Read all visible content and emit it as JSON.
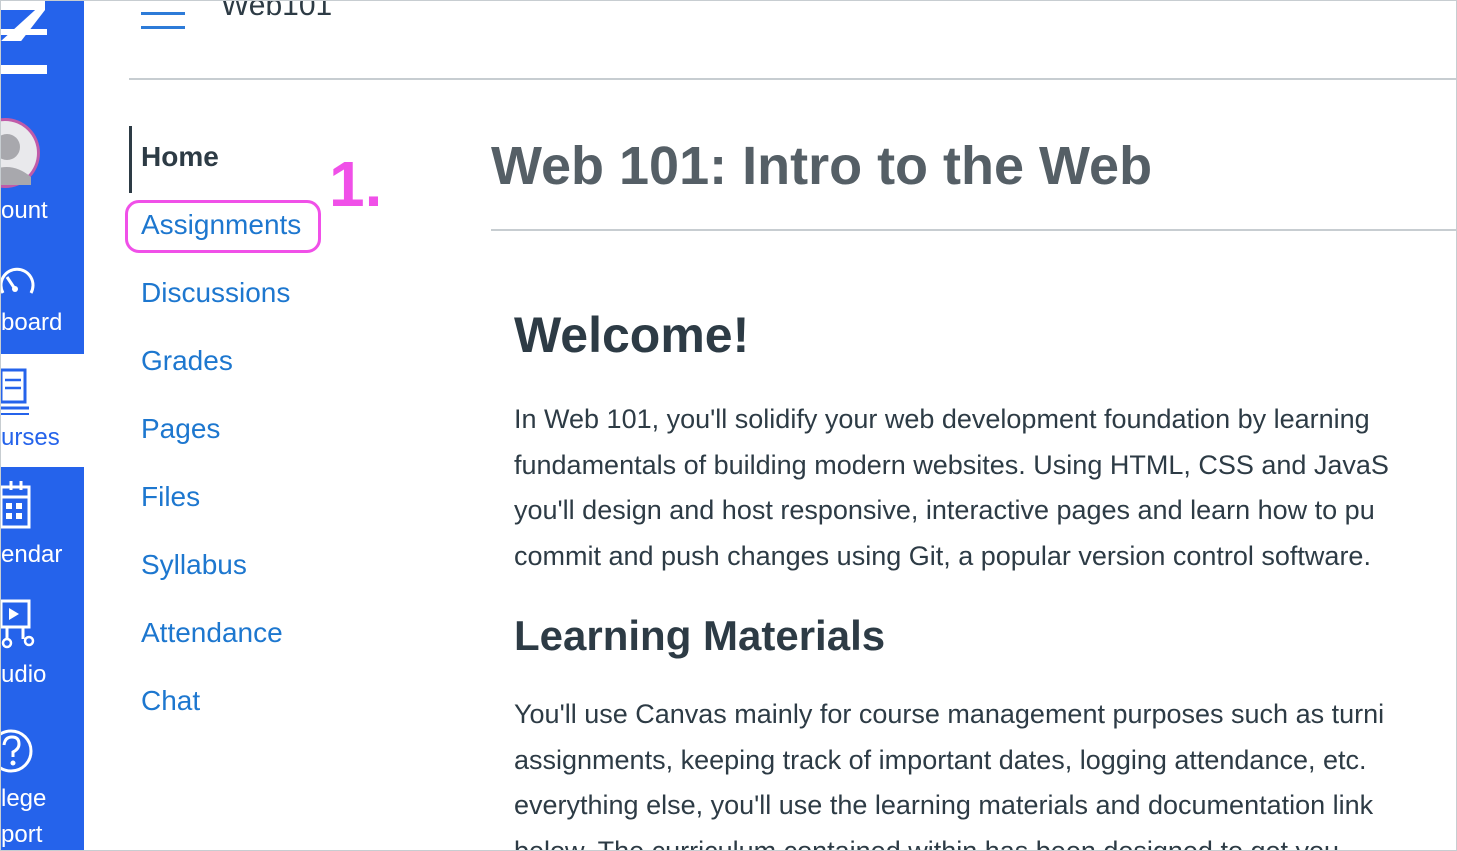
{
  "colors": {
    "global_nav_bg": "#2563eb",
    "link": "#1d77cf",
    "text": "#2d3b45",
    "annotation": "#f050e8"
  },
  "global_nav": {
    "items": [
      {
        "label": "ount",
        "icon": "user-avatar-icon"
      },
      {
        "label": "board",
        "icon": "dashboard-gauge-icon"
      },
      {
        "label": "urses",
        "icon": "courses-book-icon"
      },
      {
        "label": "endar",
        "icon": "calendar-icon"
      },
      {
        "label": "udio",
        "icon": "studio-icon"
      },
      {
        "label_line1": "lege",
        "label_line2": "port",
        "icon": "help-question-icon"
      }
    ]
  },
  "header": {
    "course_title": "Web101",
    "menu_icon": "hamburger-menu-icon"
  },
  "course_nav": {
    "items": [
      {
        "label": "Home"
      },
      {
        "label": "Assignments"
      },
      {
        "label": "Discussions"
      },
      {
        "label": "Grades"
      },
      {
        "label": "Pages"
      },
      {
        "label": "Files"
      },
      {
        "label": "Syllabus"
      },
      {
        "label": "Attendance"
      },
      {
        "label": "Chat"
      }
    ],
    "active": "Home",
    "highlighted": "Assignments"
  },
  "annotation": {
    "step": "1."
  },
  "main": {
    "page_title": "Web 101: Intro to the Web",
    "welcome_heading": "Welcome!",
    "intro_lines": [
      "In Web 101, you'll solidify your web development foundation by learning",
      "fundamentals of building modern websites. Using HTML, CSS and JavaS",
      "you'll design and host responsive, interactive pages and learn how to pu",
      "commit and push changes using Git, a popular version control software."
    ],
    "learning_heading": "Learning Materials",
    "learning_lines": [
      "You'll use Canvas mainly for course management purposes such as turni",
      "assignments, keeping track of important dates, logging attendance, etc.",
      "everything else, you'll use the learning materials and documentation link",
      "below. The curriculum contained within has been designed to get you"
    ]
  }
}
